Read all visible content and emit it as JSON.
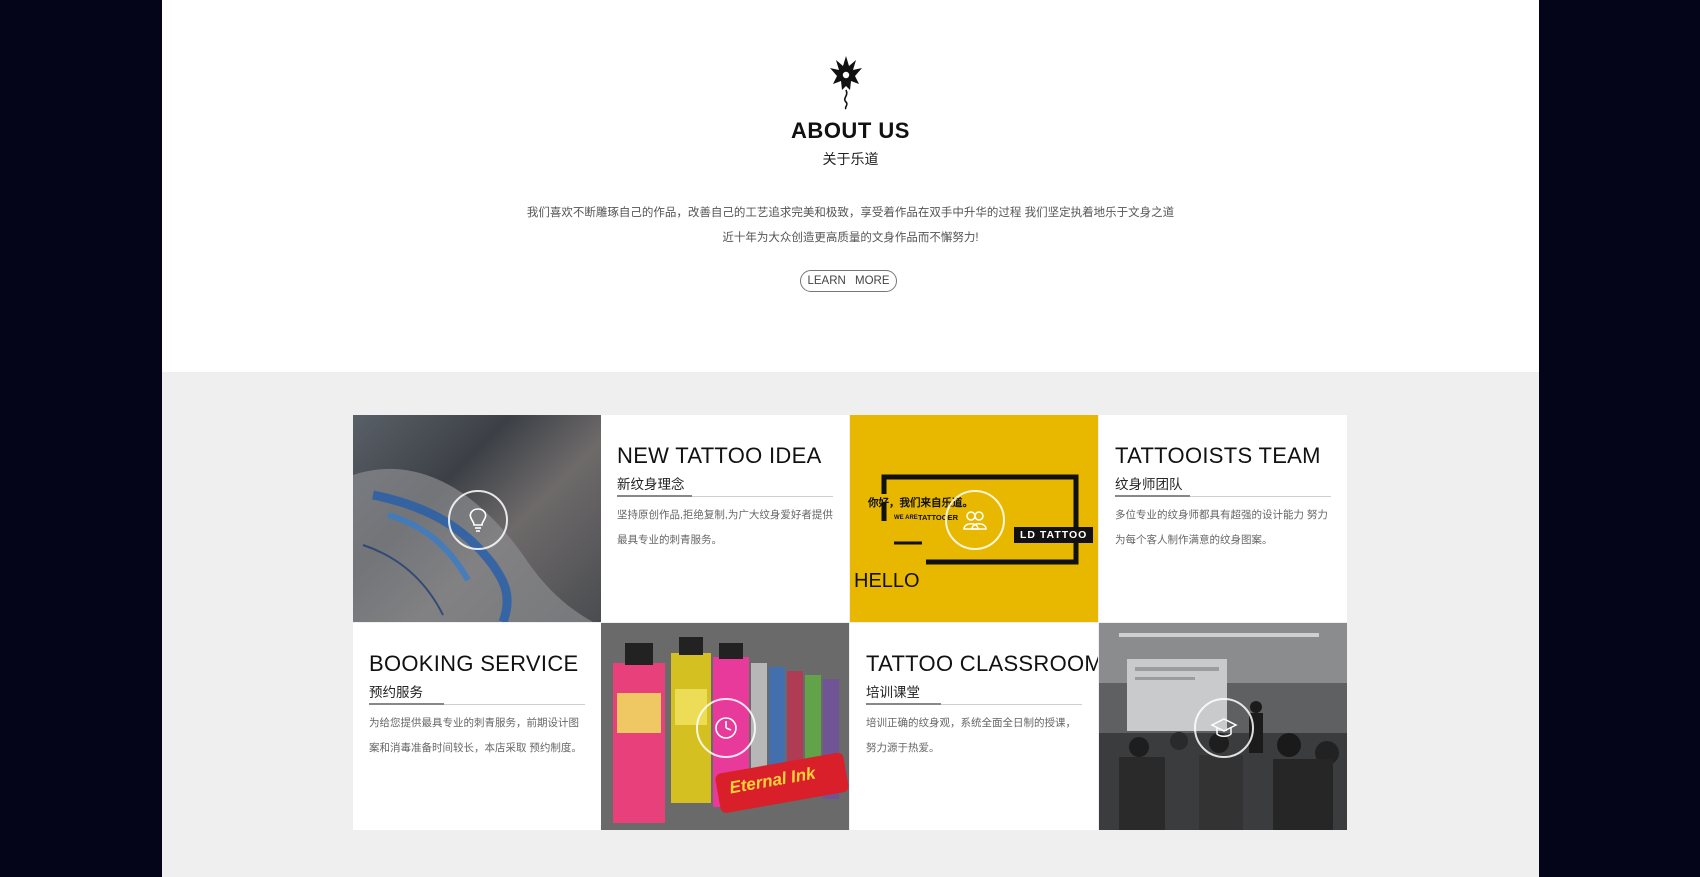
{
  "about": {
    "title": "ABOUT US",
    "subtitle": "关于乐道",
    "text_line1": "我们喜欢不断雕琢自己的作品，改善自己的工艺追求完美和极致，享受着作品在双手中升华的过程 我们坚定执着地乐于文身之道",
    "text_line2": "近十年为大众创造更高质量的文身作品而不懈努力!",
    "learn_more_label": "LEARN MORE"
  },
  "features": [
    {
      "title": "NEW TATTOO IDEA",
      "subtitle": "新纹身理念",
      "desc": "坚持原创作品,拒绝复制,为广大纹身爱好者提供最具专业的刺青服务。"
    },
    {
      "title": "TATTOOISTS TEAM",
      "subtitle": "纹身师团队",
      "desc": "多位专业的纹身师都具有超强的设计能力 努力为每个客人制作满意的纹身图案。"
    },
    {
      "title": "BOOKING SERVICE",
      "subtitle": "预约服务",
      "desc": "为给您提供最具专业的刺青服务，前期设计图案和消毒准备时间较长，本店采取 预约制度。"
    },
    {
      "title": "TATTOO CLASSROOM",
      "subtitle": "培训课堂",
      "desc": "培训正确的纹身观，系统全面全日制的授课，努力源于热爱。"
    }
  ],
  "yellow_banner": {
    "greeting": "你好，我们来自乐道。",
    "we_are": "WE ARE",
    "tattoo_word": "TATTOOER",
    "brand": "LD TATTOO",
    "hello": "HELLO"
  },
  "ink_label": "Eternal Ink",
  "colors": {
    "accent_yellow": "#e8b800",
    "background_dark": "#05051a",
    "section_grey": "#efefef"
  }
}
